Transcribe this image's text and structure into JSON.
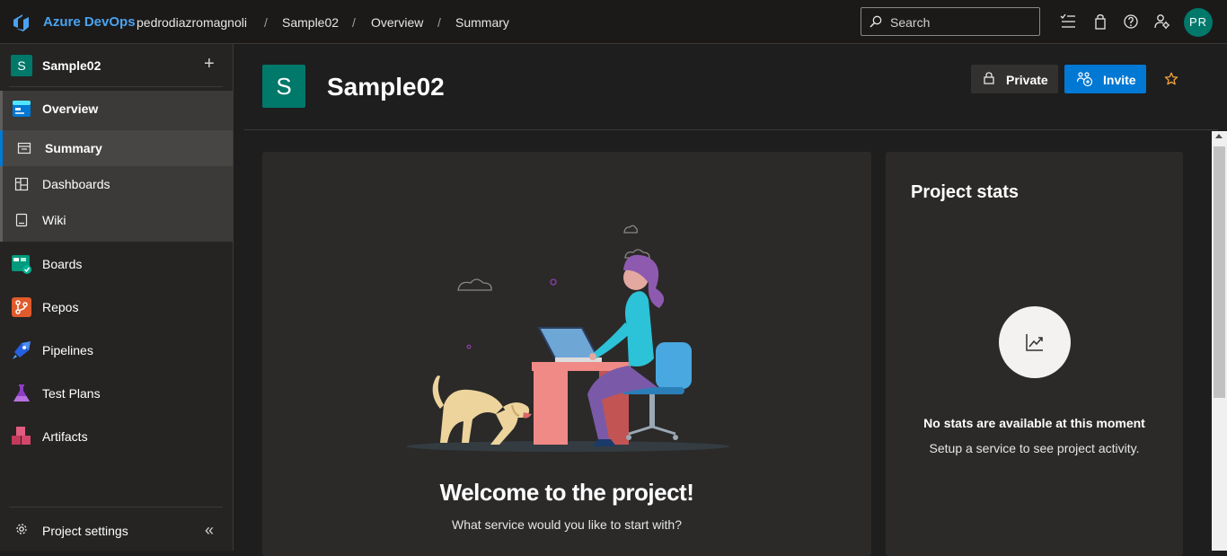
{
  "topbar": {
    "brand": "Azure DevOps",
    "breadcrumbs": [
      "pedrodiazromagnoli",
      "Sample02",
      "Overview",
      "Summary"
    ],
    "search_placeholder": "Search",
    "avatar_initials": "PR",
    "icons": [
      "task-list-icon",
      "shopping-bag-icon",
      "help-icon",
      "user-settings-icon"
    ]
  },
  "sidebar": {
    "project_initial": "S",
    "project_name": "Sample02",
    "items": [
      {
        "label": "Overview",
        "icon": "overview-icon"
      },
      {
        "label": "Summary",
        "icon": "summary-icon"
      },
      {
        "label": "Dashboards",
        "icon": "dashboards-icon"
      },
      {
        "label": "Wiki",
        "icon": "wiki-icon"
      },
      {
        "label": "Boards",
        "icon": "boards-icon"
      },
      {
        "label": "Repos",
        "icon": "repos-icon"
      },
      {
        "label": "Pipelines",
        "icon": "pipelines-icon"
      },
      {
        "label": "Test Plans",
        "icon": "test-plans-icon"
      },
      {
        "label": "Artifacts",
        "icon": "artifacts-icon"
      }
    ],
    "settings_label": "Project settings"
  },
  "header": {
    "project_initial": "S",
    "title": "Sample02",
    "private_label": "Private",
    "invite_label": "Invite"
  },
  "welcome": {
    "title": "Welcome to the project!",
    "subtitle": "What service would you like to start with?"
  },
  "stats": {
    "title": "Project stats",
    "message": "No stats are available at this moment",
    "sub": "Setup a service to see project activity."
  },
  "colors": {
    "accent": "#0078d4",
    "project_tile": "#00786a",
    "brand_text": "#4aa3f0"
  }
}
